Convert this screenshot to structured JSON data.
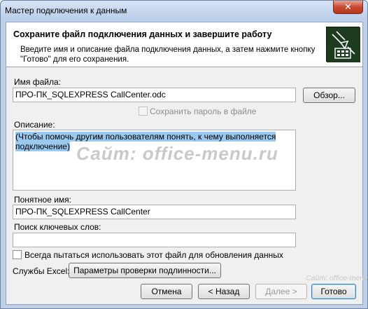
{
  "window": {
    "title": "Мастер подключения к данным",
    "close_glyph": "✕"
  },
  "header": {
    "title": "Сохраните файл подключения данных и завершите работу",
    "description": "Введите имя и описание файла подключения данных, а затем нажмите кнопку \"Готово\" для его сохранения.",
    "icon": "database-connection-wizard-icon"
  },
  "form": {
    "file_name_label": "Имя файла:",
    "file_name_value": "ПРО-ПК_SQLEXPRESS CallCenter.odc",
    "browse_button": "Обзор...",
    "save_password_label": "Сохранить пароль в файле",
    "description_label": "Описание:",
    "description_value": "(Чтобы помочь другим пользователям понять, к чему выполняется подключение)",
    "friendly_name_label": "Понятное имя:",
    "friendly_name_value": "ПРО-ПК_SQLEXPRESS CallCenter",
    "keywords_label": "Поиск ключевых слов:",
    "keywords_value": "",
    "always_use_label": "Всегда пытаться использовать этот файл для обновления данных",
    "excel_services_label": "Службы Excel:",
    "auth_settings_button": "Параметры проверки подлинности..."
  },
  "footer": {
    "cancel": "Отмена",
    "back": "< Назад",
    "next": "Далее >",
    "finish": "Готово"
  },
  "watermark": {
    "main": "Сайт: office-menu.ru",
    "corner": "Сайт: office-menu.ru"
  }
}
